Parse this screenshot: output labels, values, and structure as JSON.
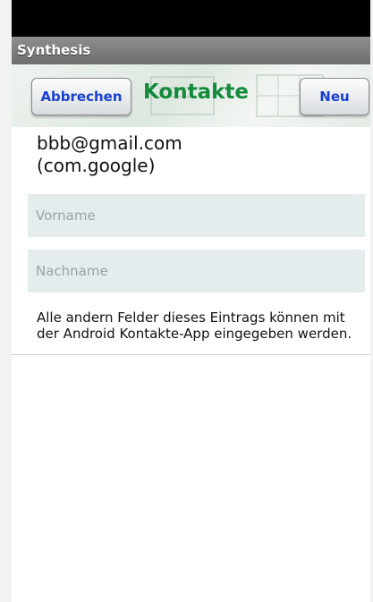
{
  "app": {
    "title": "Synthesis"
  },
  "toolbar": {
    "cancel_label": "Abbrechen",
    "title": "Kontakte",
    "new_label": "Neu"
  },
  "account": {
    "email": "bbb@gmail.com",
    "type": "(com.google)"
  },
  "fields": {
    "first_name_placeholder": "Vorname",
    "last_name_placeholder": "Nachname"
  },
  "note": "Alle andern Felder dieses Eintrags können mit der Android Kontakte-App eingegeben werden.",
  "colors": {
    "button_text": "#1a3fd0",
    "title_green": "#148a3c",
    "field_bg": "#e5ecee"
  }
}
